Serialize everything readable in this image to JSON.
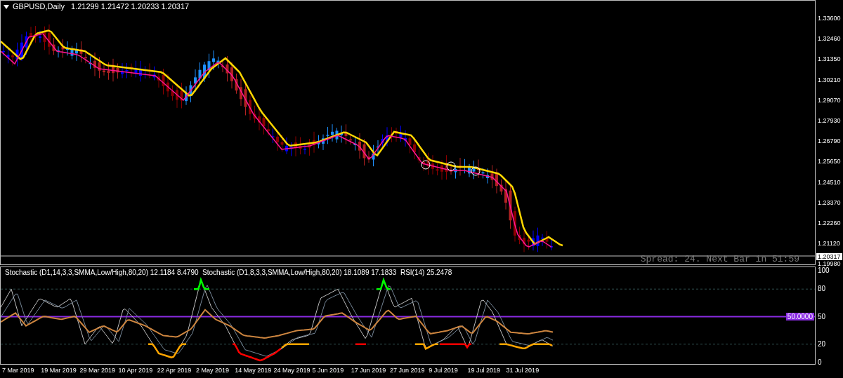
{
  "header": {
    "symbol": "GBPUSD,Daily",
    "quote": "1.21299 1.21472 1.20233 1.20317"
  },
  "price_axis": {
    "ticks": [
      "1.33600",
      "1.32460",
      "1.31350",
      "1.30210",
      "1.29070",
      "1.27930",
      "1.26790",
      "1.25650",
      "1.24510",
      "1.23370",
      "1.22260",
      "1.21120",
      "1.19980"
    ],
    "current_price": "1.20317"
  },
  "status_text": "Spread: 24. Next Bar in 51:59",
  "indicator": {
    "legend": "Stochastic (D1,14,3,3,SMMA,Low/High,80,20) 12.1184 8.4790  Stochastic (D1,8,3,3,SMMA,Low/High,80,20) 18.1089 17.1833  RSI(14) 25.2478",
    "ticks": [
      "100",
      "80",
      "20",
      "0"
    ],
    "mid_tick": "50",
    "level_label": "50.0000"
  },
  "date_axis": [
    "7 Mar 2019",
    "19 Mar 2019",
    "29 Mar 2019",
    "10 Apr 2019",
    "22 Apr 2019",
    "2 May 2019",
    "14 May 2019",
    "24 May 2019",
    "5 Jun 2019",
    "17 Jun 2019",
    "27 Jun 2019",
    "9 Jul 2019",
    "19 Jul 2019",
    "31 Jul 2019"
  ]
}
